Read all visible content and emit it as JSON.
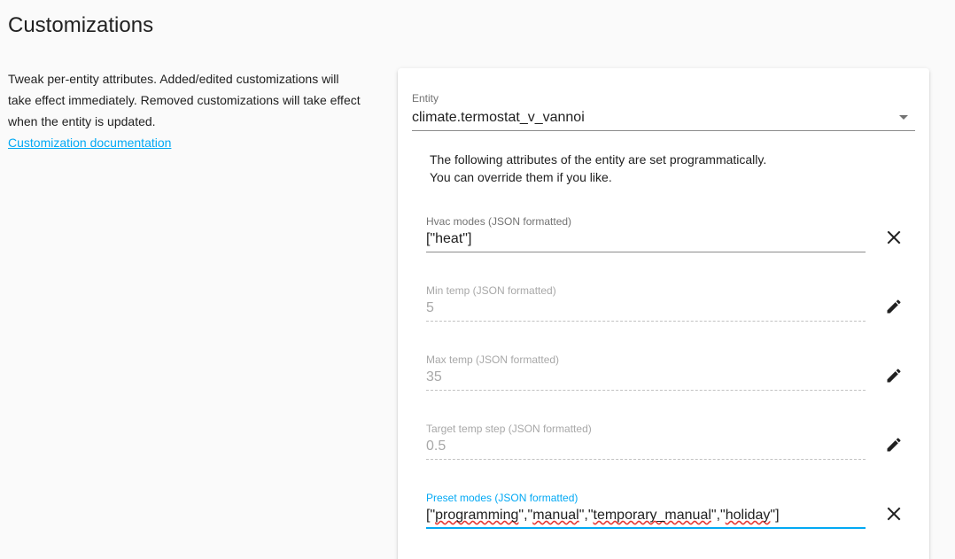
{
  "page": {
    "title": "Customizations"
  },
  "intro": {
    "description": "Tweak per-entity attributes. Added/edited customizations will take effect immediately. Removed customizations will take effect when the entity is updated.",
    "doc_link": "Customization documentation"
  },
  "entity": {
    "label": "Entity",
    "value": "climate.termostat_v_vannoi",
    "icon": "dropdown-arrow-icon"
  },
  "notice": {
    "line1": "The following attributes of the entity are set programmatically.",
    "line2": "You can override them if you like."
  },
  "attributes": [
    {
      "label": "Hvac modes (JSON formatted)",
      "value": "[\"heat\"]",
      "state": "editable",
      "action_icon": "close-icon"
    },
    {
      "label": "Min temp (JSON formatted)",
      "value": "5",
      "state": "disabled",
      "action_icon": "pencil-icon"
    },
    {
      "label": "Max temp (JSON formatted)",
      "value": "35",
      "state": "disabled",
      "action_icon": "pencil-icon"
    },
    {
      "label": "Target temp step (JSON formatted)",
      "value": "0.5",
      "state": "disabled",
      "action_icon": "pencil-icon"
    },
    {
      "label": "Preset modes (JSON formatted)",
      "value": "[\"programming\",\"manual\",\"temporary_manual\",\"holiday\"]",
      "value_parts": [
        "[\"",
        "programming",
        "\",\"",
        "manual",
        "\",\"",
        "temporary_manual",
        "\",\"",
        "holiday",
        "\"]"
      ],
      "state": "focused",
      "action_icon": "close-icon"
    }
  ],
  "colors": {
    "accent": "#03a9f4",
    "text": "#212121",
    "muted": "#737373",
    "disabled": "#a8a8a8",
    "background": "#fafafa",
    "card": "#ffffff"
  }
}
